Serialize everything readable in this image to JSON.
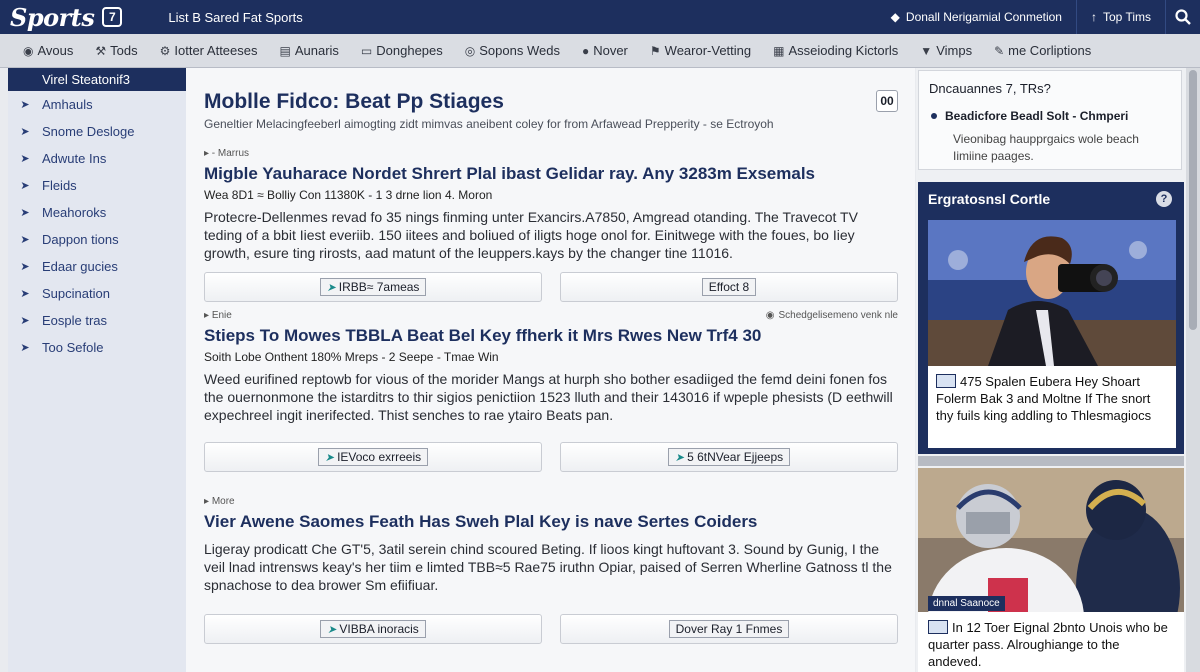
{
  "topbar": {
    "logo": "Sports",
    "logo_badge": "7",
    "center_text": "List B Sared Fat Sports",
    "links": [
      {
        "icon": "diamond-icon",
        "label": "Donall Nerigamial Conmetion"
      },
      {
        "icon": "arrow-up-icon",
        "label": "Top Tims"
      }
    ]
  },
  "nav": {
    "items": [
      {
        "icon": "eye-icon",
        "label": "Avous"
      },
      {
        "icon": "hammer-icon",
        "label": "Tods"
      },
      {
        "icon": "gear-icon",
        "label": "Iotter Atteeses"
      },
      {
        "icon": "chart-icon",
        "label": "Aunaris"
      },
      {
        "icon": "lock-icon",
        "label": "Donghepes"
      },
      {
        "icon": "target-icon",
        "label": "Sopons Weds"
      },
      {
        "icon": "globe-icon",
        "label": "Nover"
      },
      {
        "icon": "flag-icon",
        "label": "Wearor-Vetting"
      },
      {
        "icon": "grid-icon",
        "label": "Asseioding Kictorls"
      },
      {
        "icon": "pin-icon",
        "label": "Vimps"
      },
      {
        "icon": "pencil-icon",
        "label": "me Corliptions"
      }
    ]
  },
  "sidebar": {
    "header": "Virel Steatonif3",
    "items": [
      {
        "label": "Amhauls"
      },
      {
        "label": "Snome Desloge"
      },
      {
        "label": "Adwute Ins"
      },
      {
        "label": "Fleids"
      },
      {
        "label": "Meahoroks"
      },
      {
        "label": "Dappon tions"
      },
      {
        "label": "Edaar gucies"
      },
      {
        "label": "Supcination"
      },
      {
        "label": "Eosple tras"
      },
      {
        "label": "Too Sefole"
      }
    ]
  },
  "main": {
    "title": "Moblle Fidco: Beat Pp Stiages",
    "subtitle": "Geneltier Melacingfeeberl aimogting zidt mimvas aneibent coley for from Arfawead Prepperity - se Ectroyoh",
    "badge": "00",
    "articles": [
      {
        "kicker": "Marrus",
        "kicker_right": "",
        "title": "Migble Yauharace Nordet Shrert Plal ibast Gelidar ray. Any 3283m Exsemals",
        "meta": "Wea 8D1 ≈ Bolliy Con 11380K - 1 3 drne lion 4. Moron",
        "body": "Protecre-Dellenmes revad fo 35 nings finming unter Exancirs.A7850, Amgread otanding. The Travecot TV teding of a bbit Iiest everiib. 150 iitees and boliued of iligts hoge onol for. Einitwege with the foues, bo Iiey growth, esure ting rirosts, aad matunt of the leuppers.kays by the changer tine 11016.",
        "buttons": [
          {
            "icon": "arrow-left-icon",
            "label": "IRBB≈ 7ameas"
          },
          {
            "icon": "",
            "label": "Effoct 8"
          }
        ]
      },
      {
        "kicker": "Enie",
        "kicker_right": "Schedgelisemeno venk nle",
        "title": "Stieps To Mowes TBBLA Beat Bel Key ffherk it Mrs Rwes New Trf4 30",
        "meta": "Soith Lobe Onthent 180% Mreps - 2 Seepe - Tmae Win",
        "body": "Weed eurifined reptowb for vious of the morider Mangs at hurph sho bother esadiiged the femd deini fonen fos the ouernonmone the istarditrs to thir sigios penictiion 1523 lluth and their 143016 if wpeple phesists (D eethwill expechreel ingit inerifected. Thist senches to rae ytairo Beats pan.",
        "buttons": [
          {
            "icon": "arrow-left-icon",
            "label": "IEVoco exrreeis"
          },
          {
            "icon": "arrow-left-icon",
            "label": "5 6tNVear Ejjeeps"
          }
        ]
      },
      {
        "kicker": "More",
        "kicker_right": "",
        "title": "Vier Awene Saomes Feath Has Sweh Plal Key is nave Sertes Coiders",
        "meta": "",
        "body": "Ligeray prodicatt Che GT'5, 3atil serein chind scoured Beting. If lioos kingt huftovant 3. Sound by Gunig, I the veil lnad intrensws keay's her tiim e limted TBB≈5 Rae75 iruthn Opiar, paised of Serren Wherline Gatnoss tl the spnachose to dea brower Sm efiifiuar.",
        "buttons": [
          {
            "icon": "arrow-left-icon",
            "label": "VIBBA inoracis"
          },
          {
            "icon": "",
            "label": "Dover Ray 1 Fnmes"
          }
        ]
      }
    ]
  },
  "rightcol": {
    "question": "Dncauannes 7, TRs?",
    "item_title": "Beadicfore Beadl Solt - Chmperi",
    "item_desc": "Vieonibag haupprgaics wole beach Iimiine paages.",
    "card_title": "Ergratosnsl Cortle",
    "card_caption": "475 Spalen Eubera Hey Shoart Folerm Bak 3 and Moltne If The snort thy fuils king addling to Thlesmagiocs",
    "photo2_tag": "dnnal Saanoce",
    "photo2_caption": "In 12 Toer Eignal 2bnto Unois who be quarter pass. Alroughiange to the andeved."
  },
  "colors": {
    "brand_navy": "#1d2f5e",
    "link_blue": "#283d76",
    "accent_teal": "#1a8a8a"
  }
}
